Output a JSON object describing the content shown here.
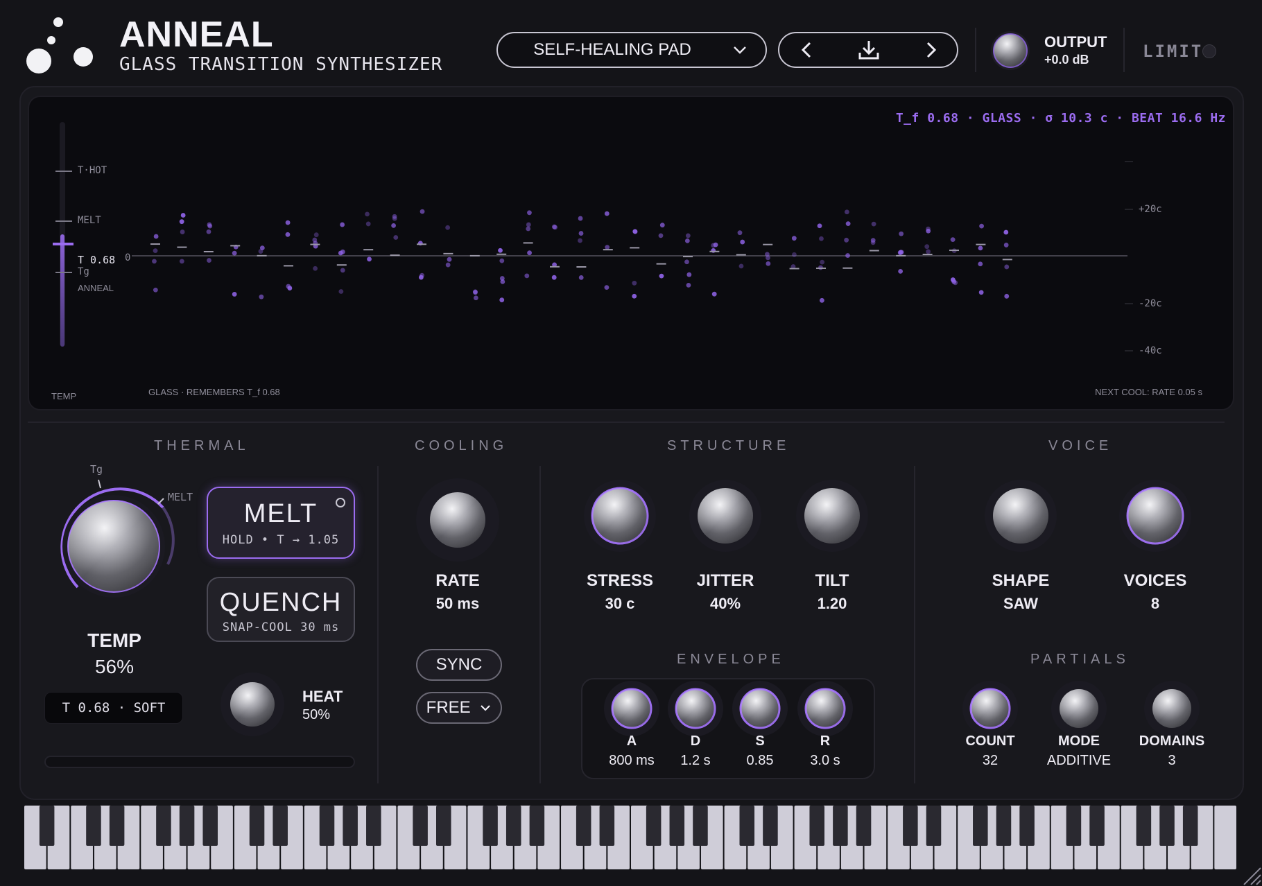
{
  "header": {
    "app_name": "ANNEAL",
    "subtitle": "GLASS TRANSITION SYNTHESIZER",
    "preset": "SELF-HEALING PAD",
    "output": {
      "label": "OUTPUT",
      "value": "+0.0 dB"
    },
    "limit_label": "LIMIT"
  },
  "display": {
    "readout": "T_f 0.68 · GLASS · σ 10.3 c · BEAT 16.6 Hz",
    "temp_markers": {
      "hot": "T·HOT",
      "melt": "MELT",
      "current": "T 0.68",
      "tg": "Tg",
      "anneal": "ANNEAL"
    },
    "zero_label": "0",
    "cent_labels": [
      "+20c",
      "-20c",
      "-40c"
    ],
    "temp_axis_label": "TEMP",
    "glass_status": "GLASS · REMEMBERS T_f 0.68",
    "next_cool": "NEXT COOL: RATE 0.05 s",
    "temp_meter_level": 0.5
  },
  "thermal": {
    "title": "THERMAL",
    "knob_tg_label": "Tg",
    "knob_melt_label": "MELT",
    "temp_label": "TEMP",
    "temp_value": "56%",
    "temp_level": 0.56,
    "melt": {
      "title": "MELT",
      "sub": "HOLD • T → 1.05"
    },
    "quench": {
      "title": "QUENCH",
      "sub": "SNAP-COOL 30 ms"
    },
    "status": "T 0.68 · SOFT",
    "heat_label": "HEAT",
    "heat_value": "50%"
  },
  "cooling": {
    "title": "COOLING",
    "rate_label": "RATE",
    "rate_value": "50 ms",
    "sync_label": "SYNC",
    "mode_value": "FREE"
  },
  "structure": {
    "title": "STRUCTURE",
    "knobs": [
      {
        "label": "STRESS",
        "value": "30 c"
      },
      {
        "label": "JITTER",
        "value": "40%"
      },
      {
        "label": "TILT",
        "value": "1.20"
      }
    ]
  },
  "envelope": {
    "title": "ENVELOPE",
    "knobs": [
      {
        "label": "A",
        "value": "800 ms"
      },
      {
        "label": "D",
        "value": "1.2 s"
      },
      {
        "label": "S",
        "value": "0.85"
      },
      {
        "label": "R",
        "value": "3.0 s"
      }
    ]
  },
  "voice": {
    "title": "VOICE",
    "knobs": [
      {
        "label": "SHAPE",
        "value": "SAW"
      },
      {
        "label": "VOICES",
        "value": "8"
      }
    ]
  },
  "partials": {
    "title": "PARTIALS",
    "knobs": [
      {
        "label": "COUNT",
        "value": "32"
      },
      {
        "label": "MODE",
        "value": "ADDITIVE"
      },
      {
        "label": "DOMAINS",
        "value": "3"
      }
    ]
  },
  "colors": {
    "accent": "#9b6cf0",
    "panel": "#18181d",
    "display_bg": "#0b0b0f"
  }
}
